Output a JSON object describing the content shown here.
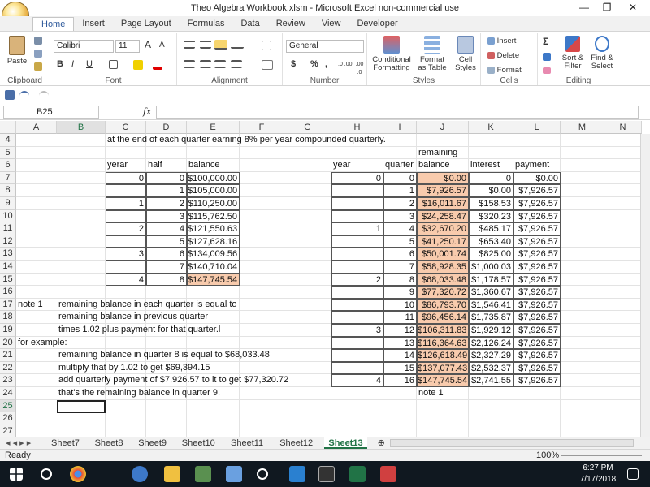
{
  "window": {
    "title": "Theo Algebra Workbook.xlsm - Microsoft Excel non-commercial use",
    "minimize": "—",
    "restore": "❐",
    "close": "✕"
  },
  "tabs": [
    "Home",
    "Insert",
    "Page Layout",
    "Formulas",
    "Data",
    "Review",
    "View",
    "Developer"
  ],
  "ribbon": {
    "clipboard": {
      "label": "Clipboard",
      "paste": "Paste"
    },
    "font": {
      "label": "Font",
      "family": "Calibri",
      "size": "11",
      "bold": "B",
      "italic": "I",
      "underline": "U",
      "grow": "A",
      "shrink": "A"
    },
    "alignment": {
      "label": "Alignment"
    },
    "number": {
      "label": "Number",
      "format": "General",
      "currency": "$",
      "percent": "%",
      "comma": ",",
      "inc_dec": ".0 .00",
      "dec_dec": ".00 .0"
    },
    "styles": {
      "label": "Styles",
      "conditional": "Conditional",
      "conditional2": "Formatting",
      "format_table": "Format",
      "format_table2": "as Table",
      "cell_styles": "Cell",
      "cell_styles2": "Styles"
    },
    "cells": {
      "label": "Cells",
      "insert": "Insert",
      "delete": "Delete",
      "format": "Format"
    },
    "editing": {
      "label": "Editing",
      "sort": "Sort &",
      "sort2": "Filter",
      "find": "Find &",
      "find2": "Select"
    }
  },
  "formula": {
    "namebox": "B25",
    "fx": "fx",
    "value": ""
  },
  "columns": [
    "A",
    "B",
    "C",
    "D",
    "E",
    "F",
    "G",
    "H",
    "I",
    "J",
    "K",
    "L",
    "M",
    "N"
  ],
  "rows": [
    "4",
    "5",
    "6",
    "7",
    "8",
    "9",
    "10",
    "11",
    "12",
    "13",
    "14",
    "15",
    "16",
    "17",
    "18",
    "19",
    "20",
    "21",
    "22",
    "23",
    "24",
    "25",
    "26",
    "27"
  ],
  "text": {
    "r4": "at the end of each quarter earning 8% per year compounded quarterly.",
    "remaining": "remaining",
    "yerar": "yerar",
    "half": "half",
    "balance": "balance",
    "year": "year",
    "quarter": "quarter",
    "interest": "interest",
    "payment": "payment",
    "balance2": "balance",
    "note1a": "note 1",
    "note1b": "note 1",
    "n17": "remaining balance in each quarter is equal to",
    "n18": "remaining balance in previous quarter",
    "n19": "times 1.02 plus payment for that quarter.l",
    "n20": "for example:",
    "n21": "remaining balance in quarter 8 is equal to $68,033.48",
    "n22": "multiply that by 1.02 to get $69,394.15",
    "n23": "add quarterly payment of $7,926.57 to it to get $77,320.72",
    "n24": "that's the remaining balance in quarter 9."
  },
  "left_table": {
    "yerar": [
      "0",
      "",
      "1",
      "",
      "2",
      "",
      "3",
      "",
      "4"
    ],
    "half": [
      "0",
      "1",
      "2",
      "3",
      "4",
      "5",
      "6",
      "7",
      "8"
    ],
    "balance": [
      "$100,000.00",
      "$105,000.00",
      "$110,250.00",
      "$115,762.50",
      "$121,550.63",
      "$127,628.16",
      "$134,009.56",
      "$140,710.04",
      "$147,745.54"
    ]
  },
  "right_table": {
    "year": [
      "0",
      "",
      "",
      "",
      "1",
      "",
      "",
      "",
      "2",
      "",
      "",
      "",
      "3",
      "",
      "",
      "",
      "4"
    ],
    "quarter": [
      "0",
      "1",
      "2",
      "3",
      "4",
      "5",
      "6",
      "7",
      "8",
      "9",
      "10",
      "11",
      "12",
      "13",
      "14",
      "15",
      "16"
    ],
    "balance": [
      "$0.00",
      "$7,926.57",
      "$16,011.67",
      "$24,258.47",
      "$32,670.20",
      "$41,250.17",
      "$50,001.74",
      "$58,928.35",
      "$68,033.48",
      "$77,320.72",
      "$86,793.70",
      "$96,456.14",
      "$106,311.83",
      "$116,364.63",
      "$126,618.49",
      "$137,077.43",
      "$147,745.54"
    ],
    "interest": [
      "0",
      "$0.00",
      "$158.53",
      "$320.23",
      "$485.17",
      "$653.40",
      "$825.00",
      "$1,000.03",
      "$1,178.57",
      "$1,360.67",
      "$1,546.41",
      "$1,735.87",
      "$1,929.12",
      "$2,126.24",
      "$2,327.29",
      "$2,532.37",
      "$2,741.55"
    ],
    "payment": [
      "$0.00",
      "$7,926.57",
      "$7,926.57",
      "$7,926.57",
      "$7,926.57",
      "$7,926.57",
      "$7,926.57",
      "$7,926.57",
      "$7,926.57",
      "$7,926.57",
      "$7,926.57",
      "$7,926.57",
      "$7,926.57",
      "$7,926.57",
      "$7,926.57",
      "$7,926.57",
      "$7,926.57"
    ]
  },
  "sheets": [
    "Sheet7",
    "Sheet8",
    "Sheet9",
    "Sheet10",
    "Sheet11",
    "Sheet12",
    "Sheet13"
  ],
  "active_sheet": "Sheet13",
  "status": {
    "ready": "Ready",
    "zoom": "100%"
  },
  "clock": {
    "time": "6:27 PM",
    "date": "7/17/2018"
  },
  "colors": {
    "accent": "#217346",
    "pink": "#f8cbad"
  }
}
